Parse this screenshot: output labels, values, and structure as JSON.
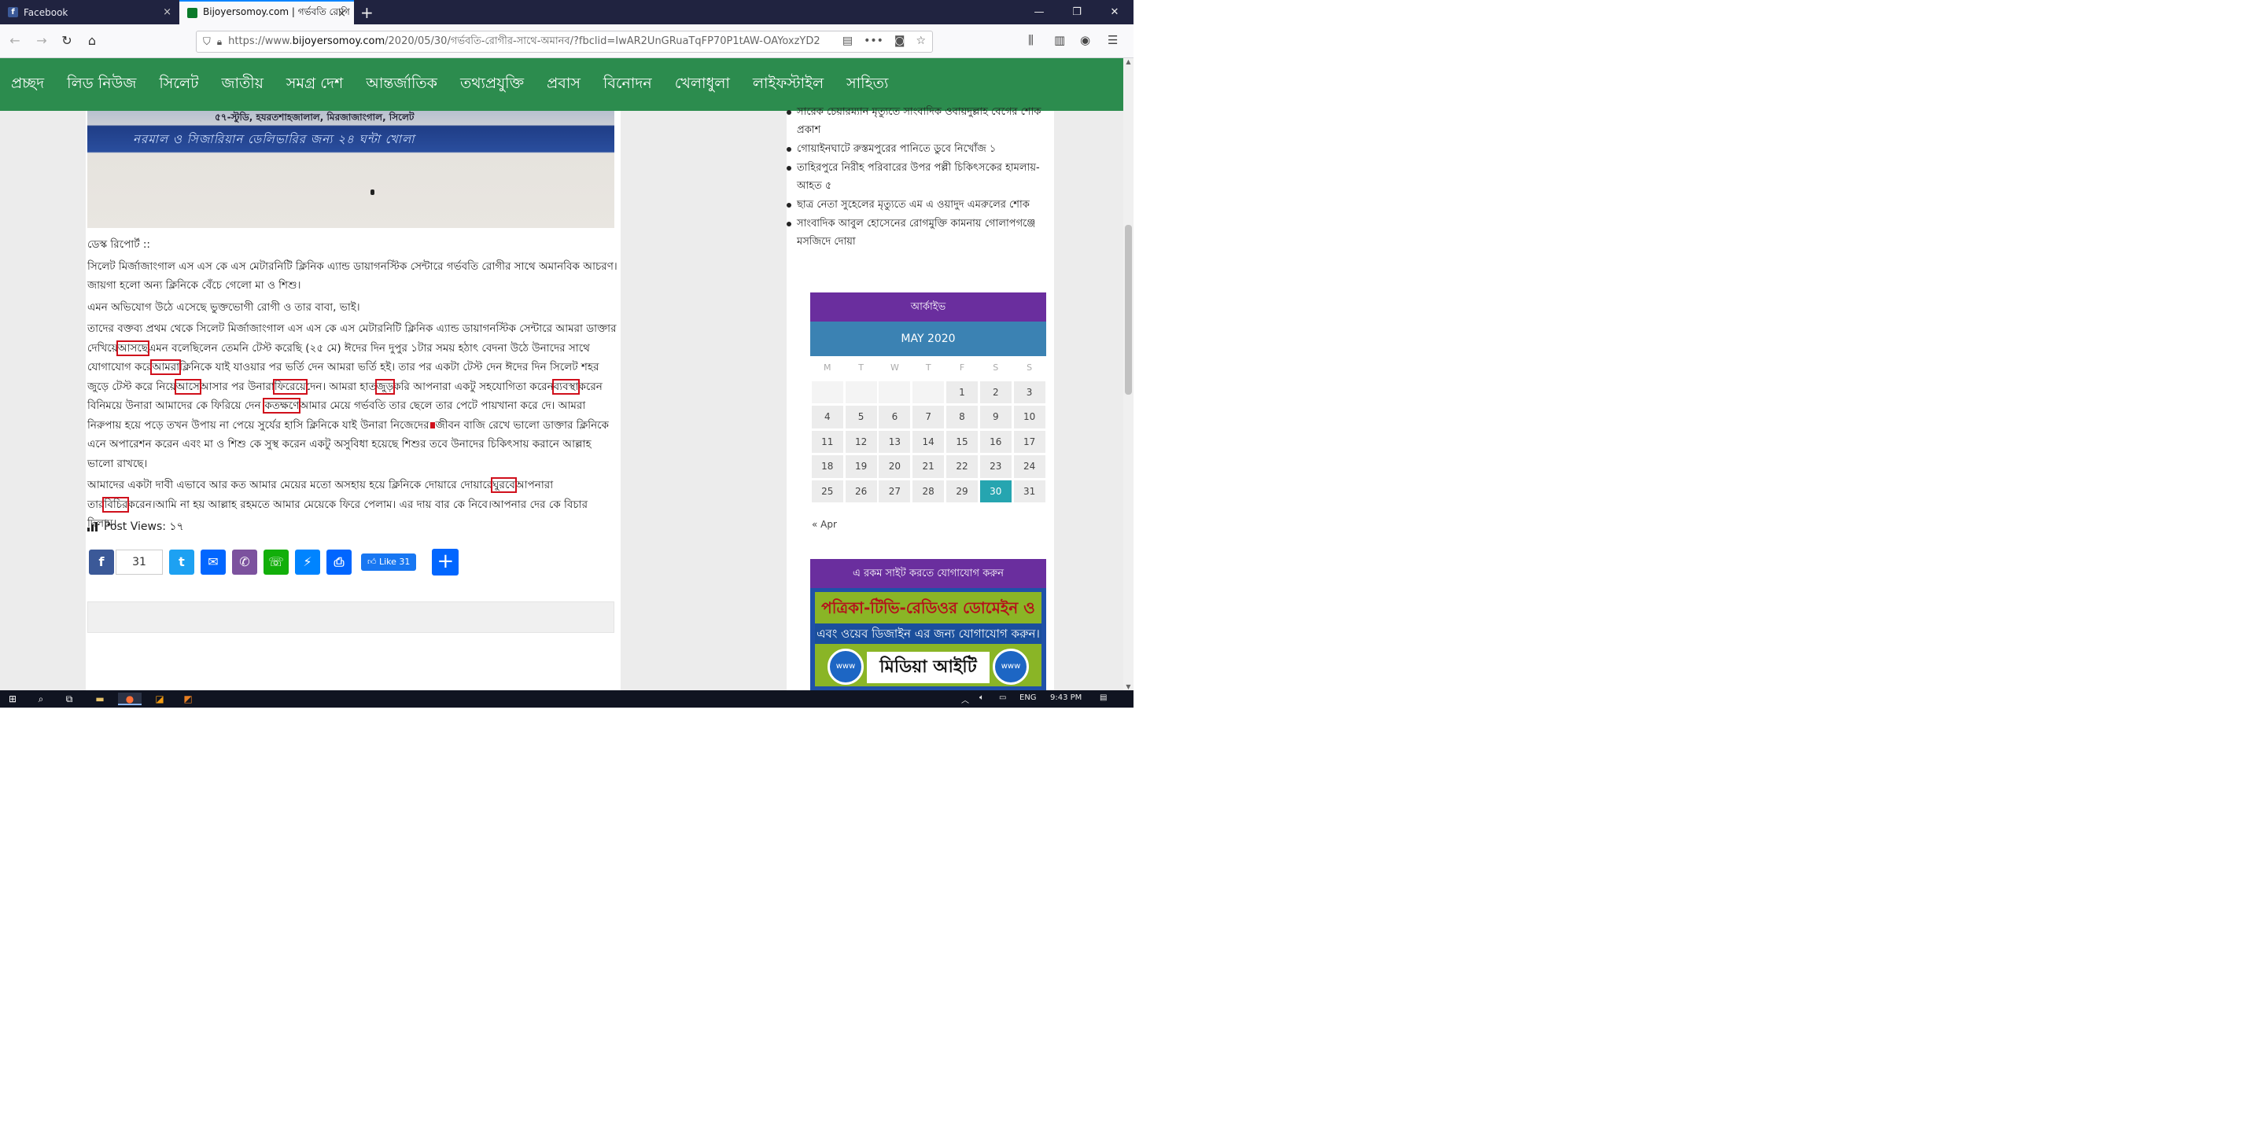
{
  "browser": {
    "tabs": [
      {
        "title": "Facebook",
        "close": "×"
      },
      {
        "title": "Bijoyersomoy.com | গর্ভবতি রোগি",
        "close": "×"
      }
    ],
    "new_tab": "+",
    "window_controls": {
      "minimize": "—",
      "maximize": "❐",
      "close": "✕"
    },
    "url_prefix": "https://www.",
    "url_domain": "bijoyersomoy.com",
    "url_rest": "/2020/05/30/গর্ভবতি-রোগীর-সাথে-অমানব/?fbclid=IwAR2UnGRuaTqFP70P1tAW-OAYoxzYD2",
    "url_more": "•••"
  },
  "site_nav": [
    "প্রচ্ছদ",
    "লিড নিউজ",
    "সিলেট",
    "জাতীয়",
    "সমগ্র দেশ",
    "আন্তর্জাতিক",
    "তথ্যপ্রযুক্তি",
    "প্রবাস",
    "বিনোদন",
    "খেলাধুলা",
    "লাইফস্টাইল",
    "সাহিত্য"
  ],
  "hero": {
    "line1": "৫৭-স্টুডি, হযরতশাহজালাল, মিরজাজাংগাল, সিলেট",
    "line2": "নরমাল ও সিজারিয়ান ডেলিভারির জন্য ২৪ ঘন্টা খোলা"
  },
  "article": {
    "byline": "ডেস্ক রিপোর্ট ::",
    "p1": "সিলেট  মির্জাজাংগাল এস এস কে এস মেটারনিটি ক্লিনিক এ্যান্ড ডায়াগনস্টিক সেন্টারে গর্ভবতি রোগীর সাথে অমানবিক আচরণ। জায়গা হলো অন্য ক্লিনিকে বেঁচে গেলো মা ও শিশু।",
    "p2": "এমন অভিযোগ উঠে এসেছে ভুক্তভোগী রোগী ও তার বাবা, ভাই।",
    "p3_parts": [
      "তাদের বক্তব্য প্রথম থেকে সিলেট  মির্জাজাংগাল এস এস কে এস মেটারনিটি ক্লিনিক এ্যান্ড ডায়াগনস্টিক সেন্টারে আমরা ডাক্তার দেখিয়ে",
      "আসছে",
      "এমন বলেছিলেন তেমনি টেস্ট করেছি (২৫ মে) ঈদের দিন দুপুর ১টার সময় হঠাৎ বেদনা উঠে উনাদের সাথে যোগাযোগ করে",
      "আমরা",
      "ক্লিনিকে যাই যাওয়ার পর ভর্তি দেন আমরা ভর্তি হই। তার পর একটা টেস্ট দেন ঈদের দিন সিলেট শহর জুড়ে টেস্ট করে নিয়ে",
      "আসে",
      "আসার পর উনারা",
      "ফিরেয়ে",
      "দেন। আমরা হাত",
      "জুড়",
      "করি আপনারা একটু সহযোগিতা করেন",
      "ব্যবস্থা",
      "করেন বিনিময়ে উনারা আমাদের কে ফিরিয়ে দেন।",
      "কতক্ষণে",
      "আমার মেয়ে গর্ভবতি তার ছেলে তার পেটে পায়খানা করে দে। আমরা নিরুপায় হয়ে পড়ে তখন উপায় না পেয়ে সুর্যের হাসি ক্লিনিকে যাই উনারা নিজেদের",
      "জীবন বাজি রেখে ভালো ডাক্তার ক্লিনিকে এনে অপারেশন করেন এবং মা ও শিশু কে সুস্থ করেন  একটু অসুবিধা হয়েছে শিশুর তবে উনাদের চিকিৎসায় করানে আল্লাহ ভালো রাখছে।"
    ],
    "p4_parts": [
      "আমাদের একটা দাবী এভাবে আর কত আমার মেয়ের মতো অসহায় হয়ে ক্লিনিকে দোয়ারে দোয়ারে",
      "ঘুরবে",
      "আপনারা তার",
      "বিচির",
      "করেন।আমি না হয় আল্লাহ রহমতে আমার মেয়েকে ফিরে পেলাম। এর দায় বার কে নিবে।আপনার দের কে বিচার দিলাম।"
    ],
    "post_views": "Post Views: ১৭"
  },
  "share": {
    "facebook_count": "31",
    "like_label": "Like 31",
    "plus": "+"
  },
  "sidebar": {
    "news": [
      "সারেক চেয়ারম্যান মৃত্যুতে সাংবাদিক ওবায়দুল্লাহ বেগের শোক প্রকাশ",
      "গোয়াইনঘাটে রুস্তমপুরের পানিতে ডুবে নিখোঁজ ১",
      "তাহিরপুরে নিরীহ পরিবারের উপর পল্লী চিকিৎসকের হামলায়-আহত ৫",
      "ছাত্র নেতা সুহেলের মৃত্যুতে এম এ ওয়াদুদ এমরুলের শোক",
      "সাংবাদিক আবুল হোসেনের রোগমুক্তি কামনায় গোলাপগঞ্জে মসজিদে দোয়া"
    ],
    "archive_heading": "আর্কাইভ",
    "calendar": {
      "month": "MAY 2020",
      "weekdays": [
        "M",
        "T",
        "W",
        "T",
        "F",
        "S",
        "S"
      ],
      "rows": [
        [
          "",
          "",
          "",
          "",
          "1",
          "2",
          "3"
        ],
        [
          "4",
          "5",
          "6",
          "7",
          "8",
          "9",
          "10"
        ],
        [
          "11",
          "12",
          "13",
          "14",
          "15",
          "16",
          "17"
        ],
        [
          "18",
          "19",
          "20",
          "21",
          "22",
          "23",
          "24"
        ],
        [
          "25",
          "26",
          "27",
          "28",
          "29",
          "30",
          "31"
        ]
      ],
      "today": "30",
      "prev": "« Apr"
    },
    "contact_heading": "এ রকম সাইট করতে যোগাযোগ করুন",
    "banner": {
      "line1": "পত্রিকা-টিভি-রেডিওর ডোমেইন ও হোস্টিং",
      "line2": "এবং ওয়েব ডিজাইন এর জন্য যোগাযোগ করুন।",
      "brand": "মিডিয়া আইটি",
      "logo": "www"
    }
  },
  "taskbar": {
    "lang": "ENG",
    "time": "9:43 PM"
  },
  "colors": {
    "nav_green": "#2c8c4e",
    "widget_purple": "#6a2e9e",
    "calendar_blue": "#3b82b3",
    "today_teal": "#26a5b0",
    "annotation_red": "#d0101c"
  }
}
